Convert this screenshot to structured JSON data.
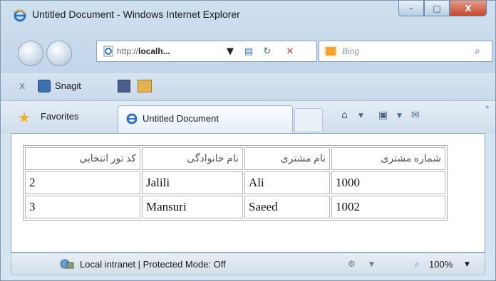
{
  "window": {
    "title": "Untitled Document - Windows Internet Explorer",
    "controls": {
      "minimize": "–",
      "maximize": "□",
      "close": "X"
    }
  },
  "address_bar": {
    "prefix": "http://",
    "host": "localh...",
    "dropdown_icon": "chevron-down-icon",
    "refresh_icon": "refresh-icon",
    "stop_icon": "stop-icon"
  },
  "search": {
    "placeholder": "Bing",
    "search_icon": "magnifier-icon"
  },
  "toolbar": {
    "close_label": "x",
    "snagit_label": "Snagit"
  },
  "favorites": {
    "label": "Favorites"
  },
  "tab": {
    "label": "Untitled Document"
  },
  "table": {
    "headers": [
      "شماره مشتری",
      "نام مشتری",
      "نام خانوادگی",
      "کد تور انتخابی"
    ],
    "rows": [
      [
        "1000",
        "Ali",
        "Jalili",
        "2"
      ],
      [
        "1002",
        "Saeed",
        "Mansuri",
        "3"
      ]
    ]
  },
  "status": {
    "zone_text": "Local intranet | Protected Mode: Off",
    "zoom": "100%"
  },
  "colors": {
    "close_button": "#c5452d",
    "favorites_star": "#f0b020",
    "bing_orange": "#f6a22c"
  }
}
